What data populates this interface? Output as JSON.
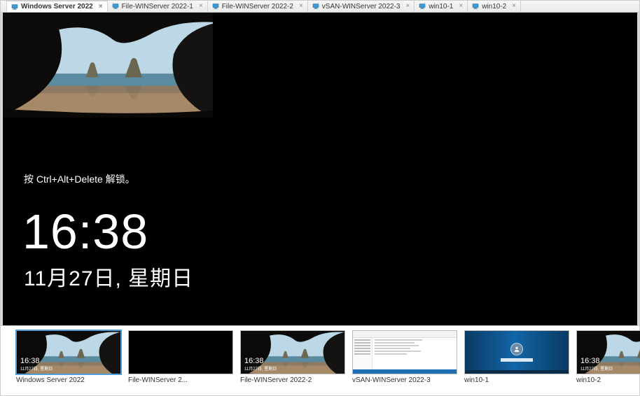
{
  "tabs": [
    {
      "label": "Windows Server 2022",
      "active": true
    },
    {
      "label": "File-WINServer 2022-1",
      "active": false
    },
    {
      "label": "File-WINServer 2022-2",
      "active": false
    },
    {
      "label": "vSAN-WINServer 2022-3",
      "active": false
    },
    {
      "label": "win10-1",
      "active": false
    },
    {
      "label": "win10-2",
      "active": false
    }
  ],
  "lock_screen": {
    "prompt": "按 Ctrl+Alt+Delete 解锁。",
    "time": "16:38",
    "date": "11月27日, 星期日"
  },
  "thumb_mini": {
    "time": "16:38",
    "date": "11月27日, 星期日"
  },
  "thumbnails": [
    {
      "label": "Windows Server 2022",
      "variant": "lockscreen",
      "active": true
    },
    {
      "label": "File-WINServer 2...",
      "variant": "black",
      "active": false
    },
    {
      "label": "File-WINServer 2022-2",
      "variant": "lockscreen",
      "active": false
    },
    {
      "label": "vSAN-WINServer 2022-3",
      "variant": "explorer",
      "active": false
    },
    {
      "label": "win10-1",
      "variant": "login",
      "active": false
    },
    {
      "label": "win10-2",
      "variant": "lockscreen",
      "active": false
    }
  ]
}
